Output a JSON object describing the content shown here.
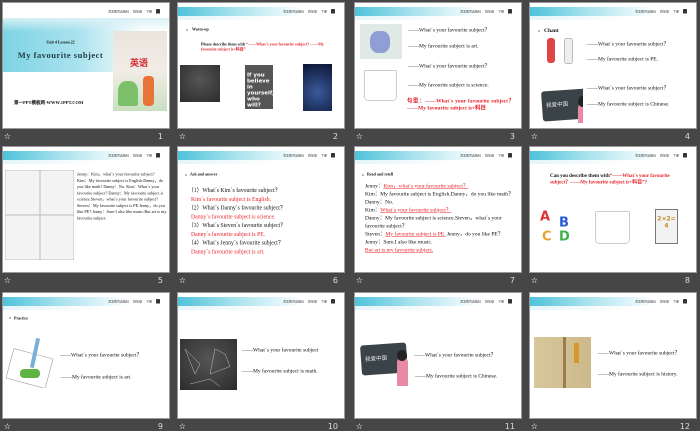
{
  "slide_header": {
    "publisher": "河北教育出版社",
    "grade": "四年级",
    "term": "下册"
  },
  "slides": [
    {
      "number": "1",
      "unit": "Unit 4 Lesson 22",
      "title": "My favourite subject",
      "book_title": "英语",
      "watermark": "第一PPT模板网-WWW.1PPT.COM"
    },
    {
      "number": "2",
      "heading": "Warm-up",
      "prompt": "Please describe them with",
      "prompt_red": "“——What´s your favourite subject? ——My favourite subject is+科目”",
      "poster_text": "If you believe in yourself, who will?"
    },
    {
      "number": "3",
      "lines": [
        "——What´s your favourite subject？",
        "——My favourite subject is art.",
        "——What´s your favourite subject？",
        "——My favourite subject is science."
      ],
      "pattern": "句型：——What´s your favourite subject？——My favourite subject is+科目"
    },
    {
      "number": "4",
      "heading": "Chant",
      "lines": [
        "——What´s your favourite subject？",
        "——My favourite subject is PE.",
        "——What´s your favourite subject？",
        "——My favourite subject is Chinese."
      ],
      "board_text": "我爱中国"
    },
    {
      "number": "5",
      "dialogue": [
        "Jenny：Kim，what´s your favourite subject?",
        "Kim：My favourite subject is English.Danny，do you like math?",
        "Danny：No.",
        "Kim：What´s your favourite subject?",
        "Danny：My favourite subject is science.Steven，what´s your favourite subject?",
        "Steven：My favourite subject is PE.Jenny，do you like PE?",
        "Jenny：Sure.I also like music.But art is my favourite subject."
      ]
    },
    {
      "number": "6",
      "heading": "Ask and answer",
      "qa": [
        {
          "q": "（1）What´s Kim´s favourite subject？",
          "a": "Kim´s favourite subject is English."
        },
        {
          "q": "（2）What´s Danny´s favourite subject？",
          "a": "Danny´s favourite subject is science."
        },
        {
          "q": "（3）What´s Steven´s favourite subject？",
          "a": "Danny´s favourite subject is PE."
        },
        {
          "q": "（4）What´s Jenny´s favourite subject？",
          "a": "Danny´s favourite subject is art."
        }
      ]
    },
    {
      "number": "7",
      "heading": "Read and retell",
      "lines": [
        {
          "pre": "Jenny：",
          "ans": "Kim，what´s your favourite subject？",
          "post": ""
        },
        {
          "pre": "Kim：My favourite subject is English.Danny，do you like math？",
          "ans": "",
          "post": ""
        },
        {
          "pre": "Danny：No.",
          "ans": "",
          "post": ""
        },
        {
          "pre": "Kim：",
          "ans": "What´s your favourite subject？",
          "post": ""
        },
        {
          "pre": "Danny：My favourite subject is science.Steven，what´s your favourite subject？",
          "ans": "",
          "post": ""
        },
        {
          "pre": "Steven：",
          "ans": "My favourite subject is PE.",
          "post": " Jenny，do you like PE？"
        },
        {
          "pre": "Jenny：Sure.I also like music.",
          "ans": "",
          "post": ""
        },
        {
          "pre": "",
          "ans": "But art is my favourite subject.",
          "post": ""
        }
      ]
    },
    {
      "number": "8",
      "prompt": "Can you describe them with",
      "prompt_red": "“——What´s your favourite subject？——My favourite subject is+科目”?",
      "math_text": "2×2=4"
    },
    {
      "number": "9",
      "heading": "Practice",
      "lines": [
        "——What´s your favourite subject？",
        "——My favourite subject is art."
      ]
    },
    {
      "number": "10",
      "lines": [
        "——What´s your favourite subject",
        "——My favourite subject is math."
      ]
    },
    {
      "number": "11",
      "lines": [
        "——What´s your favourite subject？",
        "——My favourite subject is Chinese."
      ]
    },
    {
      "number": "12",
      "lines": [
        "——What´s your favourite subject？",
        "——My favourite subject is history."
      ]
    }
  ]
}
